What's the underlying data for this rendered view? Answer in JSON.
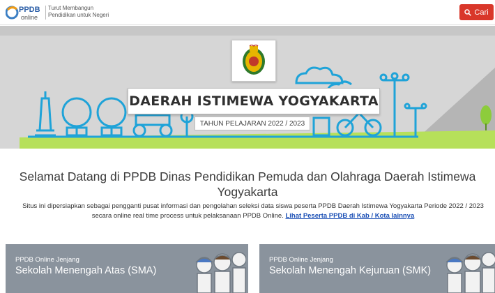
{
  "header": {
    "logo_text": "PPDB Online",
    "tagline_line1": "Turut Membangun",
    "tagline_line2": "Pendidikan untuk Negeri",
    "search_label": "Cari"
  },
  "banner": {
    "region_title": "DAERAH ISTIMEWA YOGYAKARTA",
    "academic_year": "TAHUN PELAJARAN 2022 / 2023"
  },
  "intro": {
    "welcome_line1": "Selamat Datang di PPDB Dinas Pendidikan Pemuda dan Olahraga Daerah Istimewa",
    "welcome_line2": "Yogyakarta",
    "description_line1": "Situs ini dipersiapkan sebagai pengganti pusat informasi dan pengolahan seleksi data siswa peserta PPDB Daerah Istimewa Yogyakarta Periode 2022 / 2023",
    "description_line2": "secara online real time process untuk pelaksanaan PPDB Online.",
    "other_regions_link": "Lihat Peserta PPDB di Kab / Kota lainnya"
  },
  "cards": [
    {
      "subtitle": "PPDB Online Jenjang",
      "title": "Sekolah Menengah Atas (SMA)"
    },
    {
      "subtitle": "PPDB Online Jenjang",
      "title": "Sekolah Menengah Kejuruan (SMK)"
    }
  ],
  "colors": {
    "search_button": "#d9372a",
    "banner_background": "#d6d6d6",
    "illustration_blue": "#1fa3d8",
    "grass_green": "#b6e05a",
    "card_background": "#8a939d",
    "link": "#1a4fb5"
  },
  "icons": {
    "logo": "ppdb-online-logo",
    "search": "search-icon",
    "emblem": "yogyakarta-emblem"
  }
}
